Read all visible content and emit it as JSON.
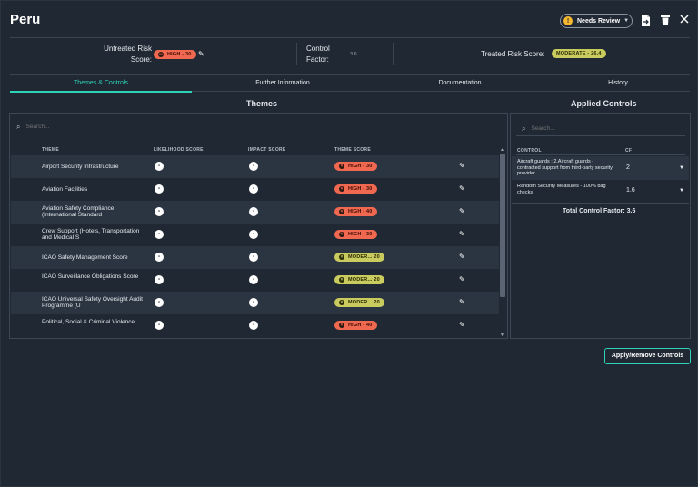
{
  "header": {
    "title": "Peru",
    "status_label": "Needs Review",
    "status_icon": "warning-icon",
    "icons": [
      "export-document-icon",
      "delete-icon",
      "close-icon"
    ]
  },
  "risk": {
    "untreated_label": "Untreated Risk Score:",
    "untreated_badge": "HIGH - 30",
    "control_factor_label": "Control Factor:",
    "control_factor_value": "3.6",
    "treated_label": "Treated Risk Score:",
    "treated_badge": "MODERATE - 26.4",
    "colors": {
      "high": "#f0684f",
      "moderate": "#c9cb5e",
      "accent": "#2ed3b7"
    }
  },
  "tabs": [
    {
      "label": "Themes & Controls",
      "active": true
    },
    {
      "label": "Further Information",
      "active": false
    },
    {
      "label": "Documentation",
      "active": false
    },
    {
      "label": "History",
      "active": false
    }
  ],
  "themes": {
    "title": "Themes",
    "search_placeholder": "Search...",
    "columns": [
      "THEME",
      "LIKELIHOOD SCORE",
      "IMPACT SCORE",
      "THEME SCORE"
    ],
    "rows": [
      {
        "name": "Airport Security Infrastructure",
        "likelihood": "-",
        "impact": "-",
        "score": "HIGH - 30",
        "level": "high"
      },
      {
        "name": "Aviation Facilities",
        "likelihood": "-",
        "impact": "-",
        "score": "HIGH - 30",
        "level": "high"
      },
      {
        "name": "Aviation Safety Compliance (International Standard",
        "likelihood": "-",
        "impact": "-",
        "score": "HIGH - 40",
        "level": "high"
      },
      {
        "name": "Crew Support (Hotels, Transportation and Medical S",
        "likelihood": "-",
        "impact": "-",
        "score": "HIGH - 30",
        "level": "high"
      },
      {
        "name": "ICAO Safety Management Score",
        "likelihood": "-",
        "impact": "-",
        "score": "MODER...  20",
        "level": "mod"
      },
      {
        "name": "ICAO Surveillance Obligations Score",
        "likelihood": "-",
        "impact": "-",
        "score": "MODER...  20",
        "level": "mod"
      },
      {
        "name": "ICAO Universal Safety Oversight Audit Programme (U",
        "likelihood": "-",
        "impact": "-",
        "score": "MODER...  20",
        "level": "mod"
      },
      {
        "name": "Political, Social & Criminal Violence",
        "likelihood": "-",
        "impact": "-",
        "score": "HIGH - 40",
        "level": "high"
      }
    ]
  },
  "controls": {
    "title": "Applied Controls",
    "search_placeholder": "Search...",
    "columns": [
      "CONTROL",
      "CF"
    ],
    "rows": [
      {
        "name": "Aircraft guards : 2.Aircraft guards - contracted support from third-party security provider",
        "cf": "2"
      },
      {
        "name": "Random Security Measures - 100% bag checks",
        "cf": "1.6"
      }
    ],
    "total_label": "Total Control Factor:",
    "total_value": "3.6"
  },
  "actions": {
    "apply_label": "Apply/Remove Controls"
  }
}
